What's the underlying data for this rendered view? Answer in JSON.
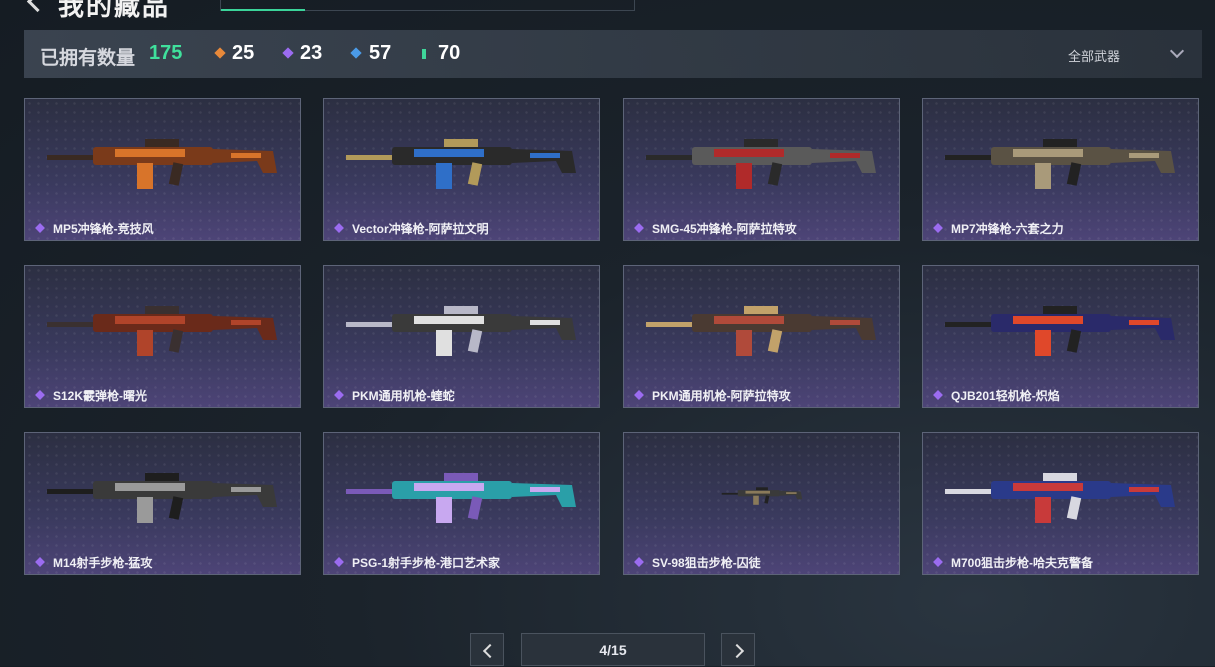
{
  "header": {
    "title": "我的藏品"
  },
  "stats": {
    "owned_label": "已拥有数量",
    "owned_total": "175",
    "rarities": [
      {
        "icon": "orange-rarity-icon",
        "color": "#e8893a",
        "count": "25"
      },
      {
        "icon": "purple-rarity-icon",
        "color": "#9b6cf0",
        "count": "23"
      },
      {
        "icon": "blue-rarity-icon",
        "color": "#4b9be8",
        "count": "57"
      },
      {
        "icon": "green-rarity-icon",
        "color": "#3fd69a",
        "count": "70"
      }
    ],
    "filter_label": "全部武器"
  },
  "items": [
    {
      "name": "MP5冲锋枪-竞技风",
      "rarity": "purple"
    },
    {
      "name": "Vector冲锋枪-阿萨拉文明",
      "rarity": "purple"
    },
    {
      "name": "SMG-45冲锋枪-阿萨拉特攻",
      "rarity": "purple"
    },
    {
      "name": "MP7冲锋枪-六套之力",
      "rarity": "purple"
    },
    {
      "name": "S12K霰弹枪-曙光",
      "rarity": "purple"
    },
    {
      "name": "PKM通用机枪-蝰蛇",
      "rarity": "purple"
    },
    {
      "name": "PKM通用机枪-阿萨拉特攻",
      "rarity": "purple"
    },
    {
      "name": "QJB201轻机枪-炽焰",
      "rarity": "purple"
    },
    {
      "name": "M14射手步枪-猛攻",
      "rarity": "purple"
    },
    {
      "name": "PSG-1射手步枪-港口艺术家",
      "rarity": "purple"
    },
    {
      "name": "SV-98狙击步枪-囚徒",
      "rarity": "purple"
    },
    {
      "name": "M700狙击步枪-哈夫克警备",
      "rarity": "purple"
    }
  ],
  "pager": {
    "page": "4/15"
  }
}
